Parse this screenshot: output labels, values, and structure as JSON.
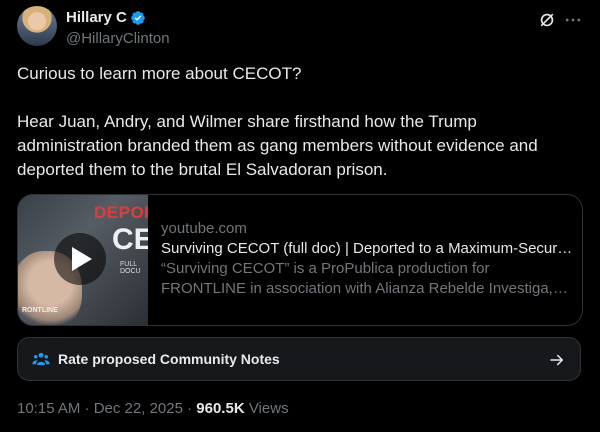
{
  "author": {
    "name": "Hillary C",
    "handle": "@HillaryClinton",
    "verified_color": "#1d9bf0"
  },
  "icons": [
    "verified-badge-icon",
    "grok-icon",
    "more-icon",
    "play-icon",
    "people-icon",
    "arrow-right-icon"
  ],
  "tweet": {
    "line1": "Curious to learn more about CECOT?",
    "line2": "Hear Juan, Andry, and Wilmer share firsthand how the Trump administration branded them as gang members without evidence and deported them to the brutal El Salvadoran prison."
  },
  "card": {
    "domain": "youtube.com",
    "title": "Surviving CECOT (full doc) | Deported to a Maximum-Security Prison",
    "description": "“Surviving CECOT” is a ProPublica production for FRONTLINE in association with Alianza Rebelde Investiga, Inc.",
    "thumb_text_1": "DEPORTE",
    "thumb_text_2": "CEC",
    "thumb_text_3": "FULL DOCU",
    "thumb_brand": "RONTLINE"
  },
  "community_notes": {
    "label": "Rate proposed Community Notes"
  },
  "meta": {
    "time": "10:15 AM · Dec 22, 2025 · ",
    "views_count": "960.5K",
    "views_label": " Views"
  }
}
